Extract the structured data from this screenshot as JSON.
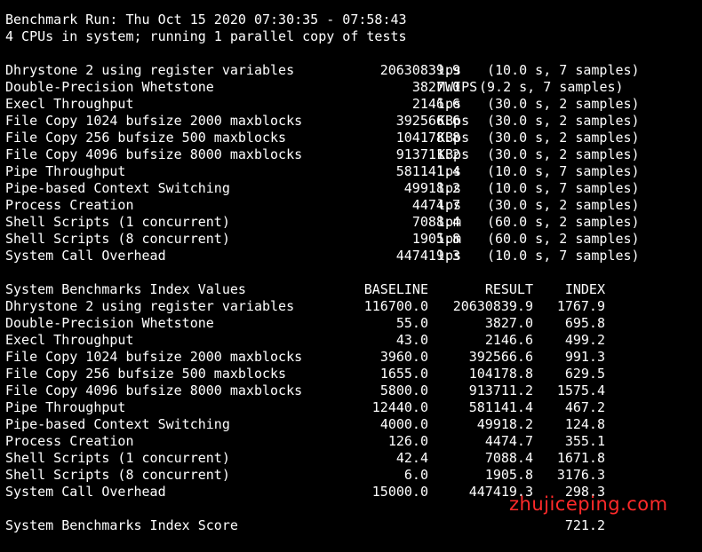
{
  "header": {
    "separator": "--------------------------------------------------------------------------",
    "run_line": "Benchmark Run: Thu Oct 15 2020 07:30:35 - 07:58:43",
    "cpu_line": "4 CPUs in system; running 1 parallel copy of tests"
  },
  "results": [
    {
      "name": "Dhrystone 2 using register variables",
      "value": "20630839.9",
      "unit": "lps",
      "detail": "(10.0 s, 7 samples)"
    },
    {
      "name": "Double-Precision Whetstone",
      "value": "3827.0",
      "unit": "MWIPS",
      "detail": "(9.2 s, 7 samples)"
    },
    {
      "name": "Execl Throughput",
      "value": "2146.6",
      "unit": "lps",
      "detail": "(30.0 s, 2 samples)"
    },
    {
      "name": "File Copy 1024 bufsize 2000 maxblocks",
      "value": "392566.6",
      "unit": "KBps",
      "detail": "(30.0 s, 2 samples)"
    },
    {
      "name": "File Copy 256 bufsize 500 maxblocks",
      "value": "104178.8",
      "unit": "KBps",
      "detail": "(30.0 s, 2 samples)"
    },
    {
      "name": "File Copy 4096 bufsize 8000 maxblocks",
      "value": "913711.2",
      "unit": "KBps",
      "detail": "(30.0 s, 2 samples)"
    },
    {
      "name": "Pipe Throughput",
      "value": "581141.4",
      "unit": "lps",
      "detail": "(10.0 s, 7 samples)"
    },
    {
      "name": "Pipe-based Context Switching",
      "value": "49918.2",
      "unit": "lps",
      "detail": "(10.0 s, 7 samples)"
    },
    {
      "name": "Process Creation",
      "value": "4474.7",
      "unit": "lps",
      "detail": "(30.0 s, 2 samples)"
    },
    {
      "name": "Shell Scripts (1 concurrent)",
      "value": "7088.4",
      "unit": "lpm",
      "detail": "(60.0 s, 2 samples)"
    },
    {
      "name": "Shell Scripts (8 concurrent)",
      "value": "1905.8",
      "unit": "lpm",
      "detail": "(60.0 s, 2 samples)"
    },
    {
      "name": "System Call Overhead",
      "value": "447419.3",
      "unit": "lps",
      "detail": "(10.0 s, 7 samples)"
    }
  ],
  "index_table": {
    "title": "System Benchmarks Index Values",
    "headers": {
      "baseline": "BASELINE",
      "result": "RESULT",
      "index": "INDEX"
    },
    "rows": [
      {
        "name": "Dhrystone 2 using register variables",
        "baseline": "116700.0",
        "result": "20630839.9",
        "index": "1767.9"
      },
      {
        "name": "Double-Precision Whetstone",
        "baseline": "55.0",
        "result": "3827.0",
        "index": "695.8"
      },
      {
        "name": "Execl Throughput",
        "baseline": "43.0",
        "result": "2146.6",
        "index": "499.2"
      },
      {
        "name": "File Copy 1024 bufsize 2000 maxblocks",
        "baseline": "3960.0",
        "result": "392566.6",
        "index": "991.3"
      },
      {
        "name": "File Copy 256 bufsize 500 maxblocks",
        "baseline": "1655.0",
        "result": "104178.8",
        "index": "629.5"
      },
      {
        "name": "File Copy 4096 bufsize 8000 maxblocks",
        "baseline": "5800.0",
        "result": "913711.2",
        "index": "1575.4"
      },
      {
        "name": "Pipe Throughput",
        "baseline": "12440.0",
        "result": "581141.4",
        "index": "467.2"
      },
      {
        "name": "Pipe-based Context Switching",
        "baseline": "4000.0",
        "result": "49918.2",
        "index": "124.8"
      },
      {
        "name": "Process Creation",
        "baseline": "126.0",
        "result": "4474.7",
        "index": "355.1"
      },
      {
        "name": "Shell Scripts (1 concurrent)",
        "baseline": "42.4",
        "result": "7088.4",
        "index": "1671.8"
      },
      {
        "name": "Shell Scripts (8 concurrent)",
        "baseline": "6.0",
        "result": "1905.8",
        "index": "3176.3"
      },
      {
        "name": "System Call Overhead",
        "baseline": "15000.0",
        "result": "447419.3",
        "index": "298.3"
      }
    ]
  },
  "score": {
    "label": "System Benchmarks Index Score",
    "value": "721.2"
  },
  "watermark": {
    "text": "zhujiceping.com",
    "color": "#ff2a2a"
  },
  "colors": {
    "background": "#000000",
    "text": "#ffffff"
  }
}
